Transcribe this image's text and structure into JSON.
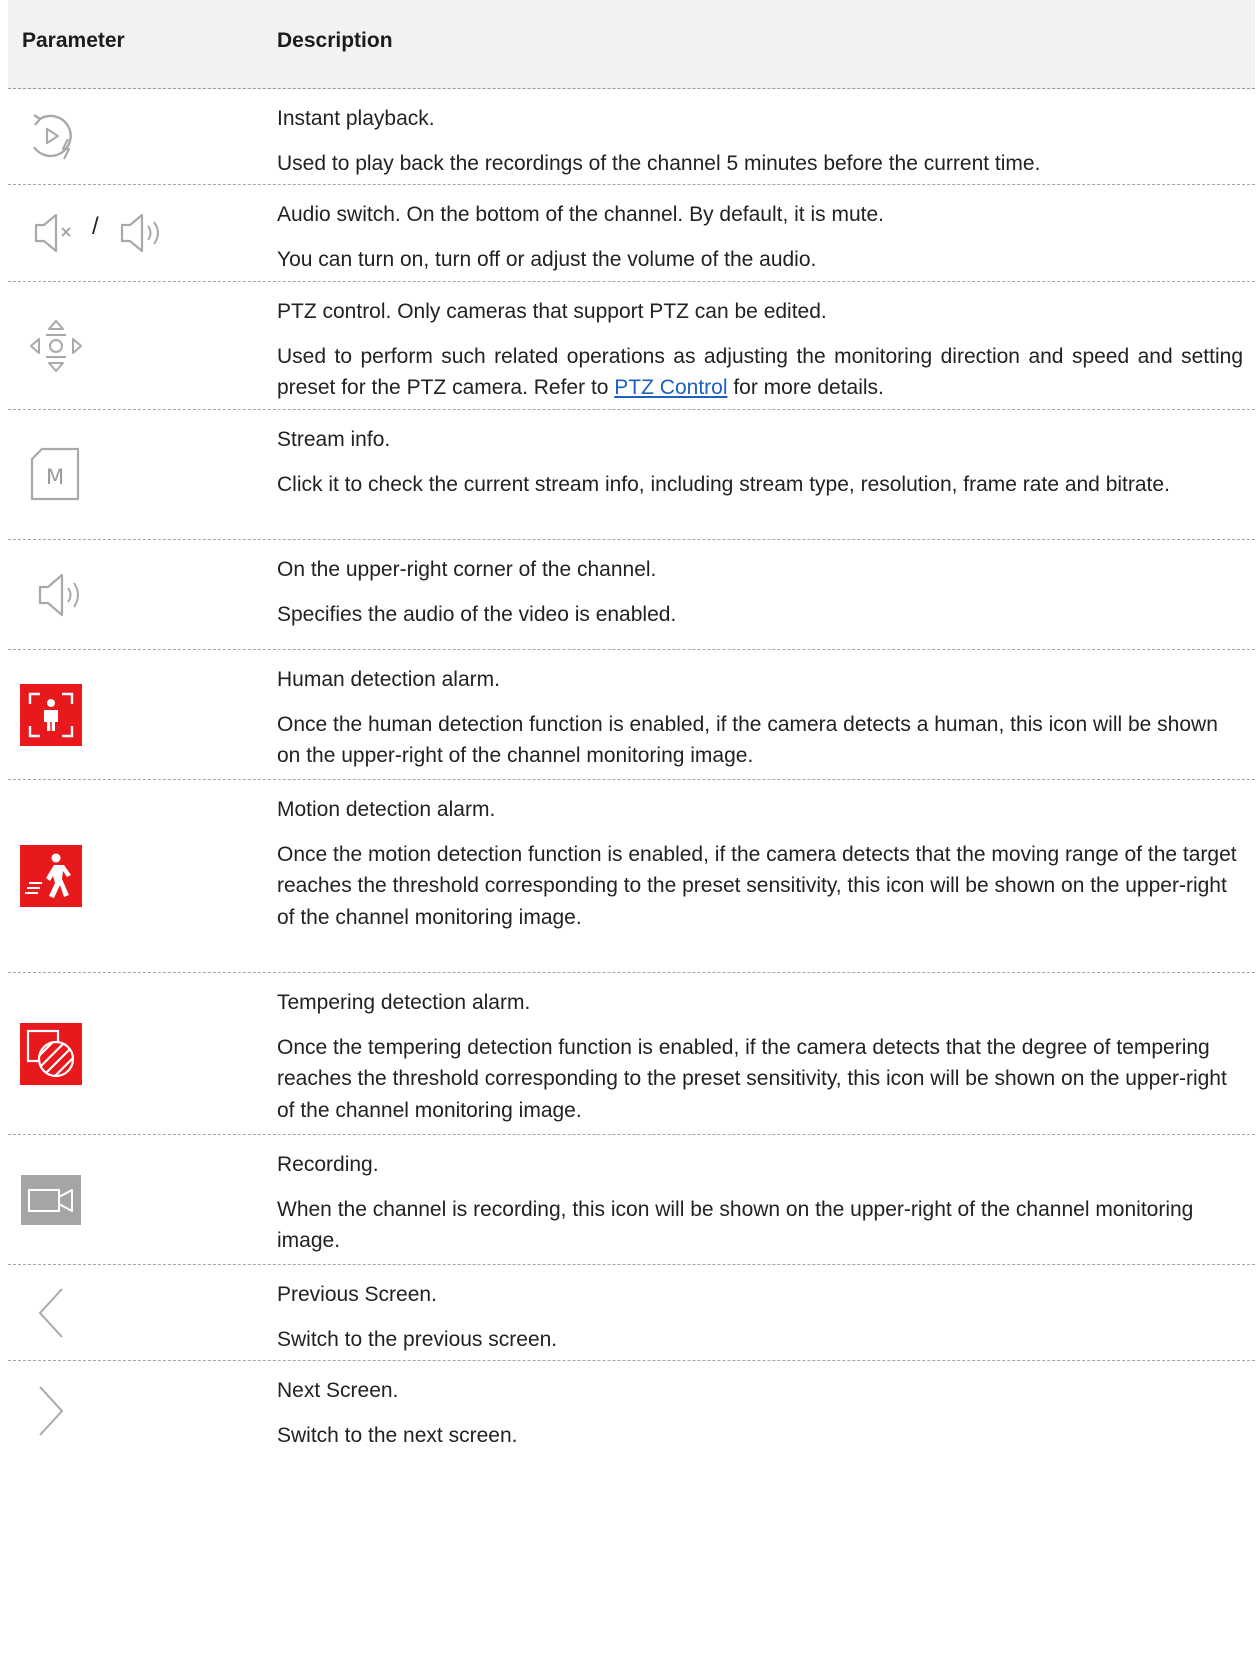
{
  "header": {
    "col_parameter": "Parameter",
    "col_description": "Description"
  },
  "rows": [
    {
      "icon": "instant-playback-icon",
      "title": "Instant playback.",
      "text": "Used to play back the recordings of the channel 5 minutes before the current time."
    },
    {
      "icon": "audio-switch-icon",
      "separator": "/",
      "title": "Audio switch. On the bottom of the channel. By default, it is mute.",
      "text": "You can turn on, turn off or adjust the volume of the audio."
    },
    {
      "icon": "ptz-control-icon",
      "title": "PTZ control. Only cameras that support PTZ can be edited.",
      "text_before": "Used to perform such related operations as adjusting the monitoring direction and speed and setting preset for the PTZ camera. Refer to ",
      "link": "PTZ Control",
      "text_after": " for more details."
    },
    {
      "icon": "stream-info-icon",
      "icon_letter": "M",
      "title": "Stream info.",
      "text": "Click it to check the current stream info, including stream type, resolution, frame rate and bitrate."
    },
    {
      "icon": "speaker-on-icon",
      "title": "On the upper-right corner of the channel.",
      "text": "Specifies the audio of the video is enabled."
    },
    {
      "icon": "human-detection-icon",
      "title": "Human detection alarm.",
      "text": "Once the human detection function is enabled, if the camera detects a human, this icon will be shown on the upper-right of the channel monitoring image."
    },
    {
      "icon": "motion-detection-icon",
      "title": "Motion detection alarm.",
      "text": "Once the motion detection function is enabled, if the camera detects that the moving range of the target reaches the threshold corresponding to the preset sensitivity, this icon will be shown on the upper-right of the channel monitoring image."
    },
    {
      "icon": "tampering-detection-icon",
      "title": "Tempering detection alarm.",
      "text": "Once the tempering detection function is enabled, if the camera detects that the degree of tempering reaches the threshold corresponding to the preset sensitivity, this icon will be shown on the upper-right of the channel monitoring image."
    },
    {
      "icon": "recording-icon",
      "title": "Recording.",
      "text": "When the channel is recording, this icon will be shown on the upper-right of the channel monitoring image."
    },
    {
      "icon": "previous-screen-icon",
      "title": "Previous Screen.",
      "text": "Switch to the previous screen."
    },
    {
      "icon": "next-screen-icon",
      "title": "Next Screen.",
      "text": "Switch to the next screen."
    }
  ],
  "colors": {
    "alarm_red": "#e8191c",
    "icon_gray": "#a9a9a9",
    "link_blue": "#1f5fbf",
    "header_bg": "#f2f2f2"
  }
}
